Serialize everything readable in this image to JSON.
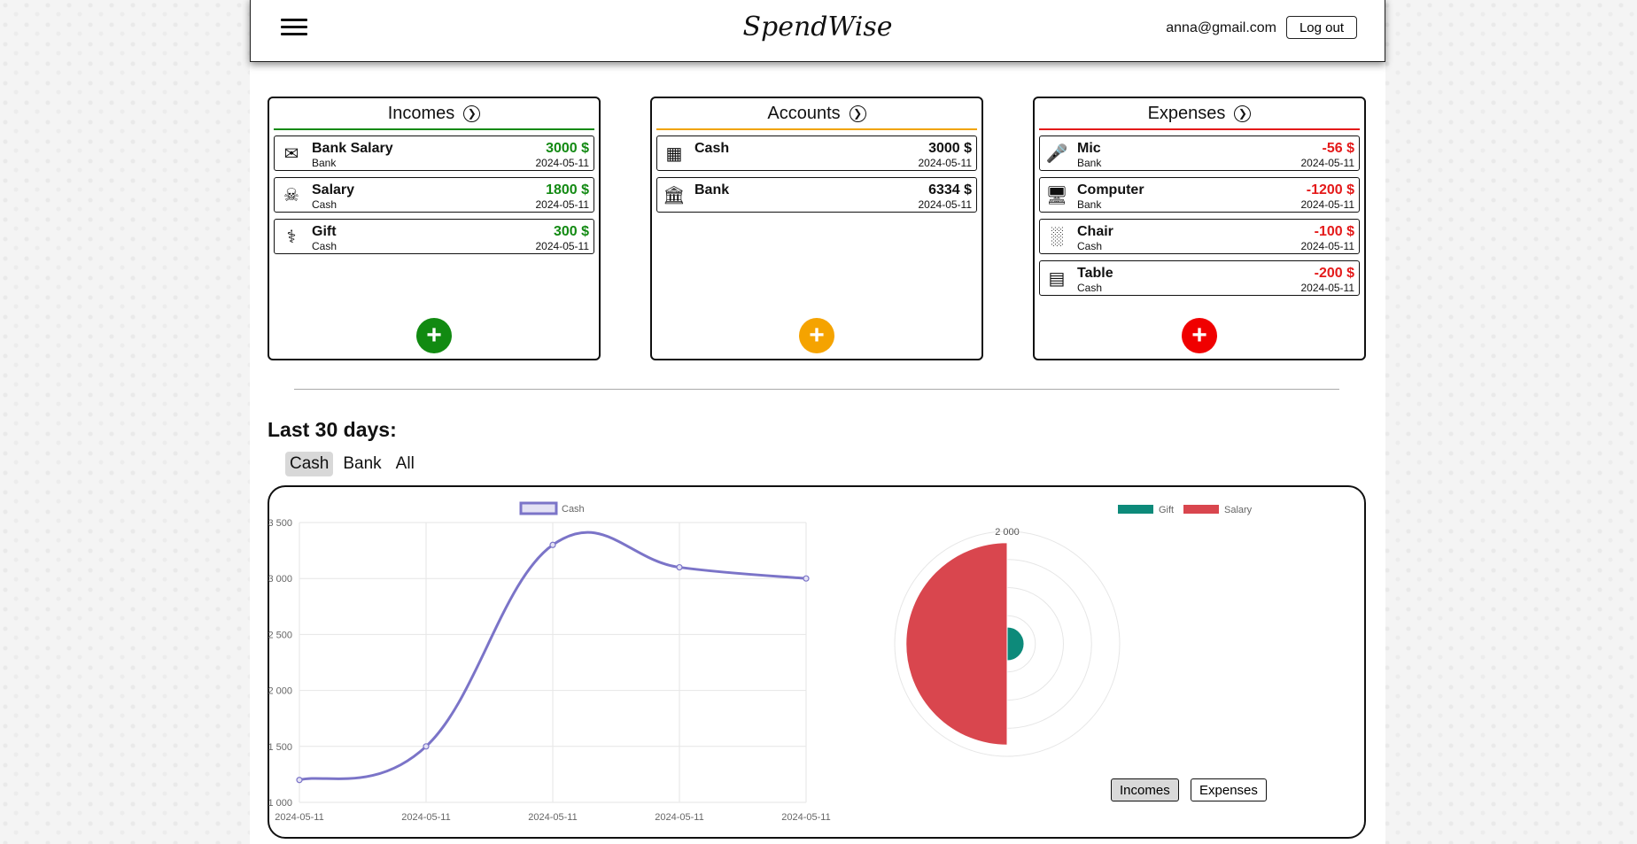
{
  "header": {
    "logo": "SpendWise",
    "user_email": "anna@gmail.com",
    "logout_label": "Log out"
  },
  "panels": {
    "incomes": {
      "title": "Incomes",
      "accent": "#138a13",
      "items": [
        {
          "icon": "envelope-money-icon",
          "name": "Bank Salary",
          "sub": "Bank",
          "amount": "3000 $",
          "date": "2024-05-11"
        },
        {
          "icon": "coins-hand-icon",
          "name": "Salary",
          "sub": "Cash",
          "amount": "1800 $",
          "date": "2024-05-11"
        },
        {
          "icon": "gift-table-icon",
          "name": "Gift",
          "sub": "Cash",
          "amount": "300 $",
          "date": "2024-05-11"
        }
      ]
    },
    "accounts": {
      "title": "Accounts",
      "accent": "#f0a400",
      "items": [
        {
          "icon": "banknote-icon",
          "name": "Cash",
          "sub": "",
          "amount": "3000 $",
          "date": "2024-05-11"
        },
        {
          "icon": "bank-building-icon",
          "name": "Bank",
          "sub": "",
          "amount": "6334 $",
          "date": "2024-05-11"
        }
      ]
    },
    "expenses": {
      "title": "Expenses",
      "accent": "#e41a1a",
      "items": [
        {
          "icon": "microphone-icon",
          "name": "Mic",
          "sub": "Bank",
          "amount": "-56 $",
          "date": "2024-05-11"
        },
        {
          "icon": "monitor-icon",
          "name": "Computer",
          "sub": "Bank",
          "amount": "-1200 $",
          "date": "2024-05-11"
        },
        {
          "icon": "chair-icon",
          "name": "Chair",
          "sub": "Cash",
          "amount": "-100 $",
          "date": "2024-05-11"
        },
        {
          "icon": "table-icon",
          "name": "Table",
          "sub": "Cash",
          "amount": "-200 $",
          "date": "2024-05-11"
        }
      ]
    }
  },
  "section": {
    "title": "Last 30 days:",
    "tabs": [
      "Cash",
      "Bank",
      "All"
    ],
    "active_tab": "Cash"
  },
  "chart_toggle": {
    "incomes_label": "Incomes",
    "expenses_label": "Expenses",
    "active": "Incomes"
  },
  "chart_data": [
    {
      "type": "line",
      "legend": [
        "Cash"
      ],
      "series": [
        {
          "name": "Cash",
          "color": "#7b74c8",
          "values": [
            1200,
            1500,
            3300,
            3100,
            3000
          ]
        }
      ],
      "x": [
        "2024-05-11",
        "2024-05-11",
        "2024-05-11",
        "2024-05-11",
        "2024-05-11"
      ],
      "yticks": [
        "1 000",
        "1 500",
        "2 000",
        "2 500",
        "3 000",
        "3 500"
      ],
      "ylim": [
        1000,
        3500
      ],
      "grid": true,
      "legend_position": "top"
    },
    {
      "type": "polarArea",
      "legend": [
        "Gift",
        "Salary"
      ],
      "categories": [
        "Gift",
        "Salary"
      ],
      "values": [
        300,
        1800
      ],
      "colors": [
        "#0d8a7a",
        "#d9464e"
      ],
      "rticks": [
        "2 000"
      ],
      "rlim": [
        0,
        2000
      ],
      "legend_position": "top"
    }
  ]
}
